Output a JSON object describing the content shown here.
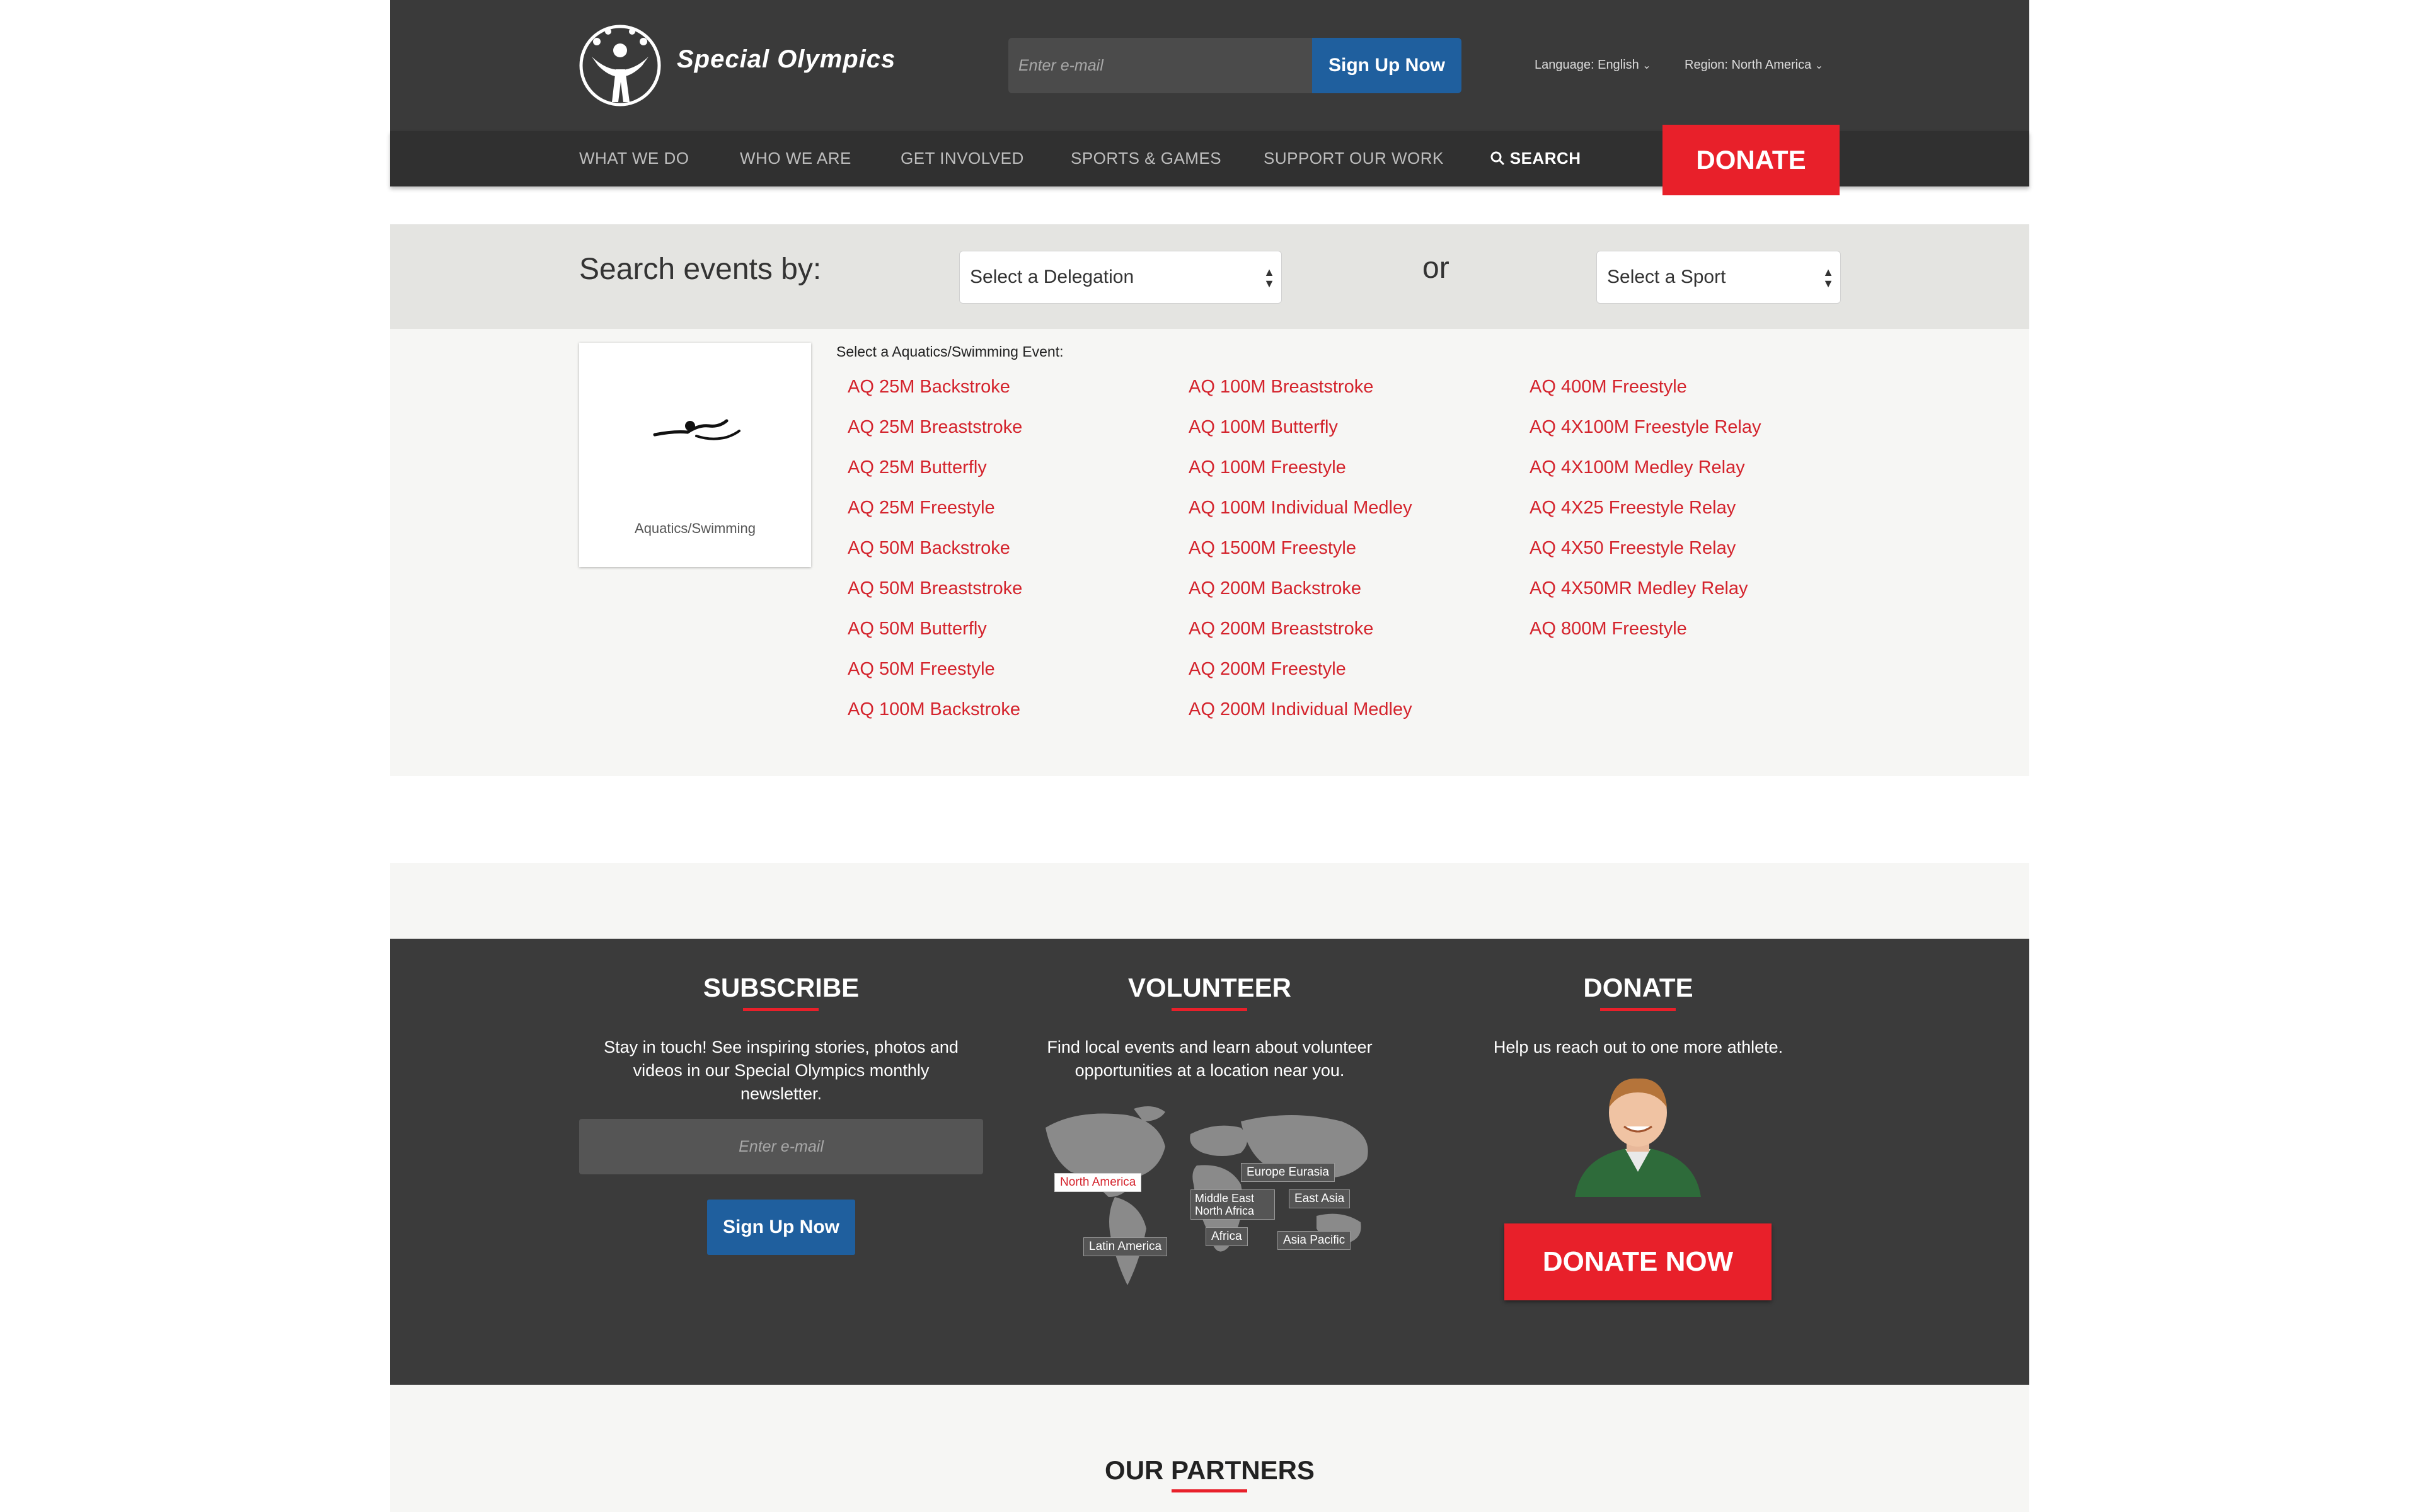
{
  "header": {
    "brand": "Special Olympics",
    "email_placeholder": "Enter e-mail",
    "signup_label": "Sign Up Now",
    "language": "Language: English",
    "region": "Region: North America"
  },
  "nav": {
    "items": [
      "WHAT WE DO",
      "WHO WE ARE",
      "GET INVOLVED",
      "SPORTS & GAMES",
      "SUPPORT OUR WORK"
    ],
    "search_label": "SEARCH",
    "donate_label": "DONATE"
  },
  "search": {
    "label": "Search events by:",
    "delegation_select": "Select a Delegation",
    "or_label": "or",
    "sport_select": "Select a Sport"
  },
  "events": {
    "sport_name": "Aquatics/Swimming",
    "heading": "Select a Aquatics/Swimming Event:",
    "columns": [
      [
        "AQ 25M Backstroke",
        "AQ 25M Breaststroke",
        "AQ 25M Butterfly",
        "AQ 25M Freestyle",
        "AQ 50M Backstroke",
        "AQ 50M Breaststroke",
        "AQ 50M Butterfly",
        "AQ 50M Freestyle",
        "AQ 100M Backstroke"
      ],
      [
        "AQ 100M Breaststroke",
        "AQ 100M Butterfly",
        "AQ 100M Freestyle",
        "AQ 100M Individual Medley",
        "AQ 1500M Freestyle",
        "AQ 200M Backstroke",
        "AQ 200M Breaststroke",
        "AQ 200M Freestyle",
        "AQ 200M Individual Medley"
      ],
      [
        "AQ 400M Freestyle",
        "AQ 4X100M Freestyle Relay",
        "AQ 4X100M Medley Relay",
        "AQ 4X25 Freestyle Relay",
        "AQ 4X50 Freestyle Relay",
        "AQ 4X50MR Medley Relay",
        "AQ 800M Freestyle"
      ]
    ]
  },
  "footer": {
    "subscribe": {
      "title": "SUBSCRIBE",
      "text": "Stay in touch! See inspiring stories, photos and videos in our Special Olympics monthly newsletter.",
      "email_placeholder": "Enter e-mail",
      "button": "Sign Up Now"
    },
    "volunteer": {
      "title": "VOLUNTEER",
      "text": "Find local events and learn about volunteer opportunities at a location near you.",
      "regions": [
        "North America",
        "Europe Eurasia",
        "Middle East North Africa",
        "East Asia",
        "Africa",
        "Latin America",
        "Asia Pacific"
      ]
    },
    "donate": {
      "title": "DONATE",
      "text": "Help us reach out to one more athlete.",
      "button": "DONATE NOW"
    }
  },
  "partners": {
    "title": "OUR PARTNERS"
  },
  "colors": {
    "accent_red": "#e8202a",
    "link_red": "#d4232c",
    "button_blue": "#1f5f9e",
    "header_dark": "#3a3a3a"
  }
}
